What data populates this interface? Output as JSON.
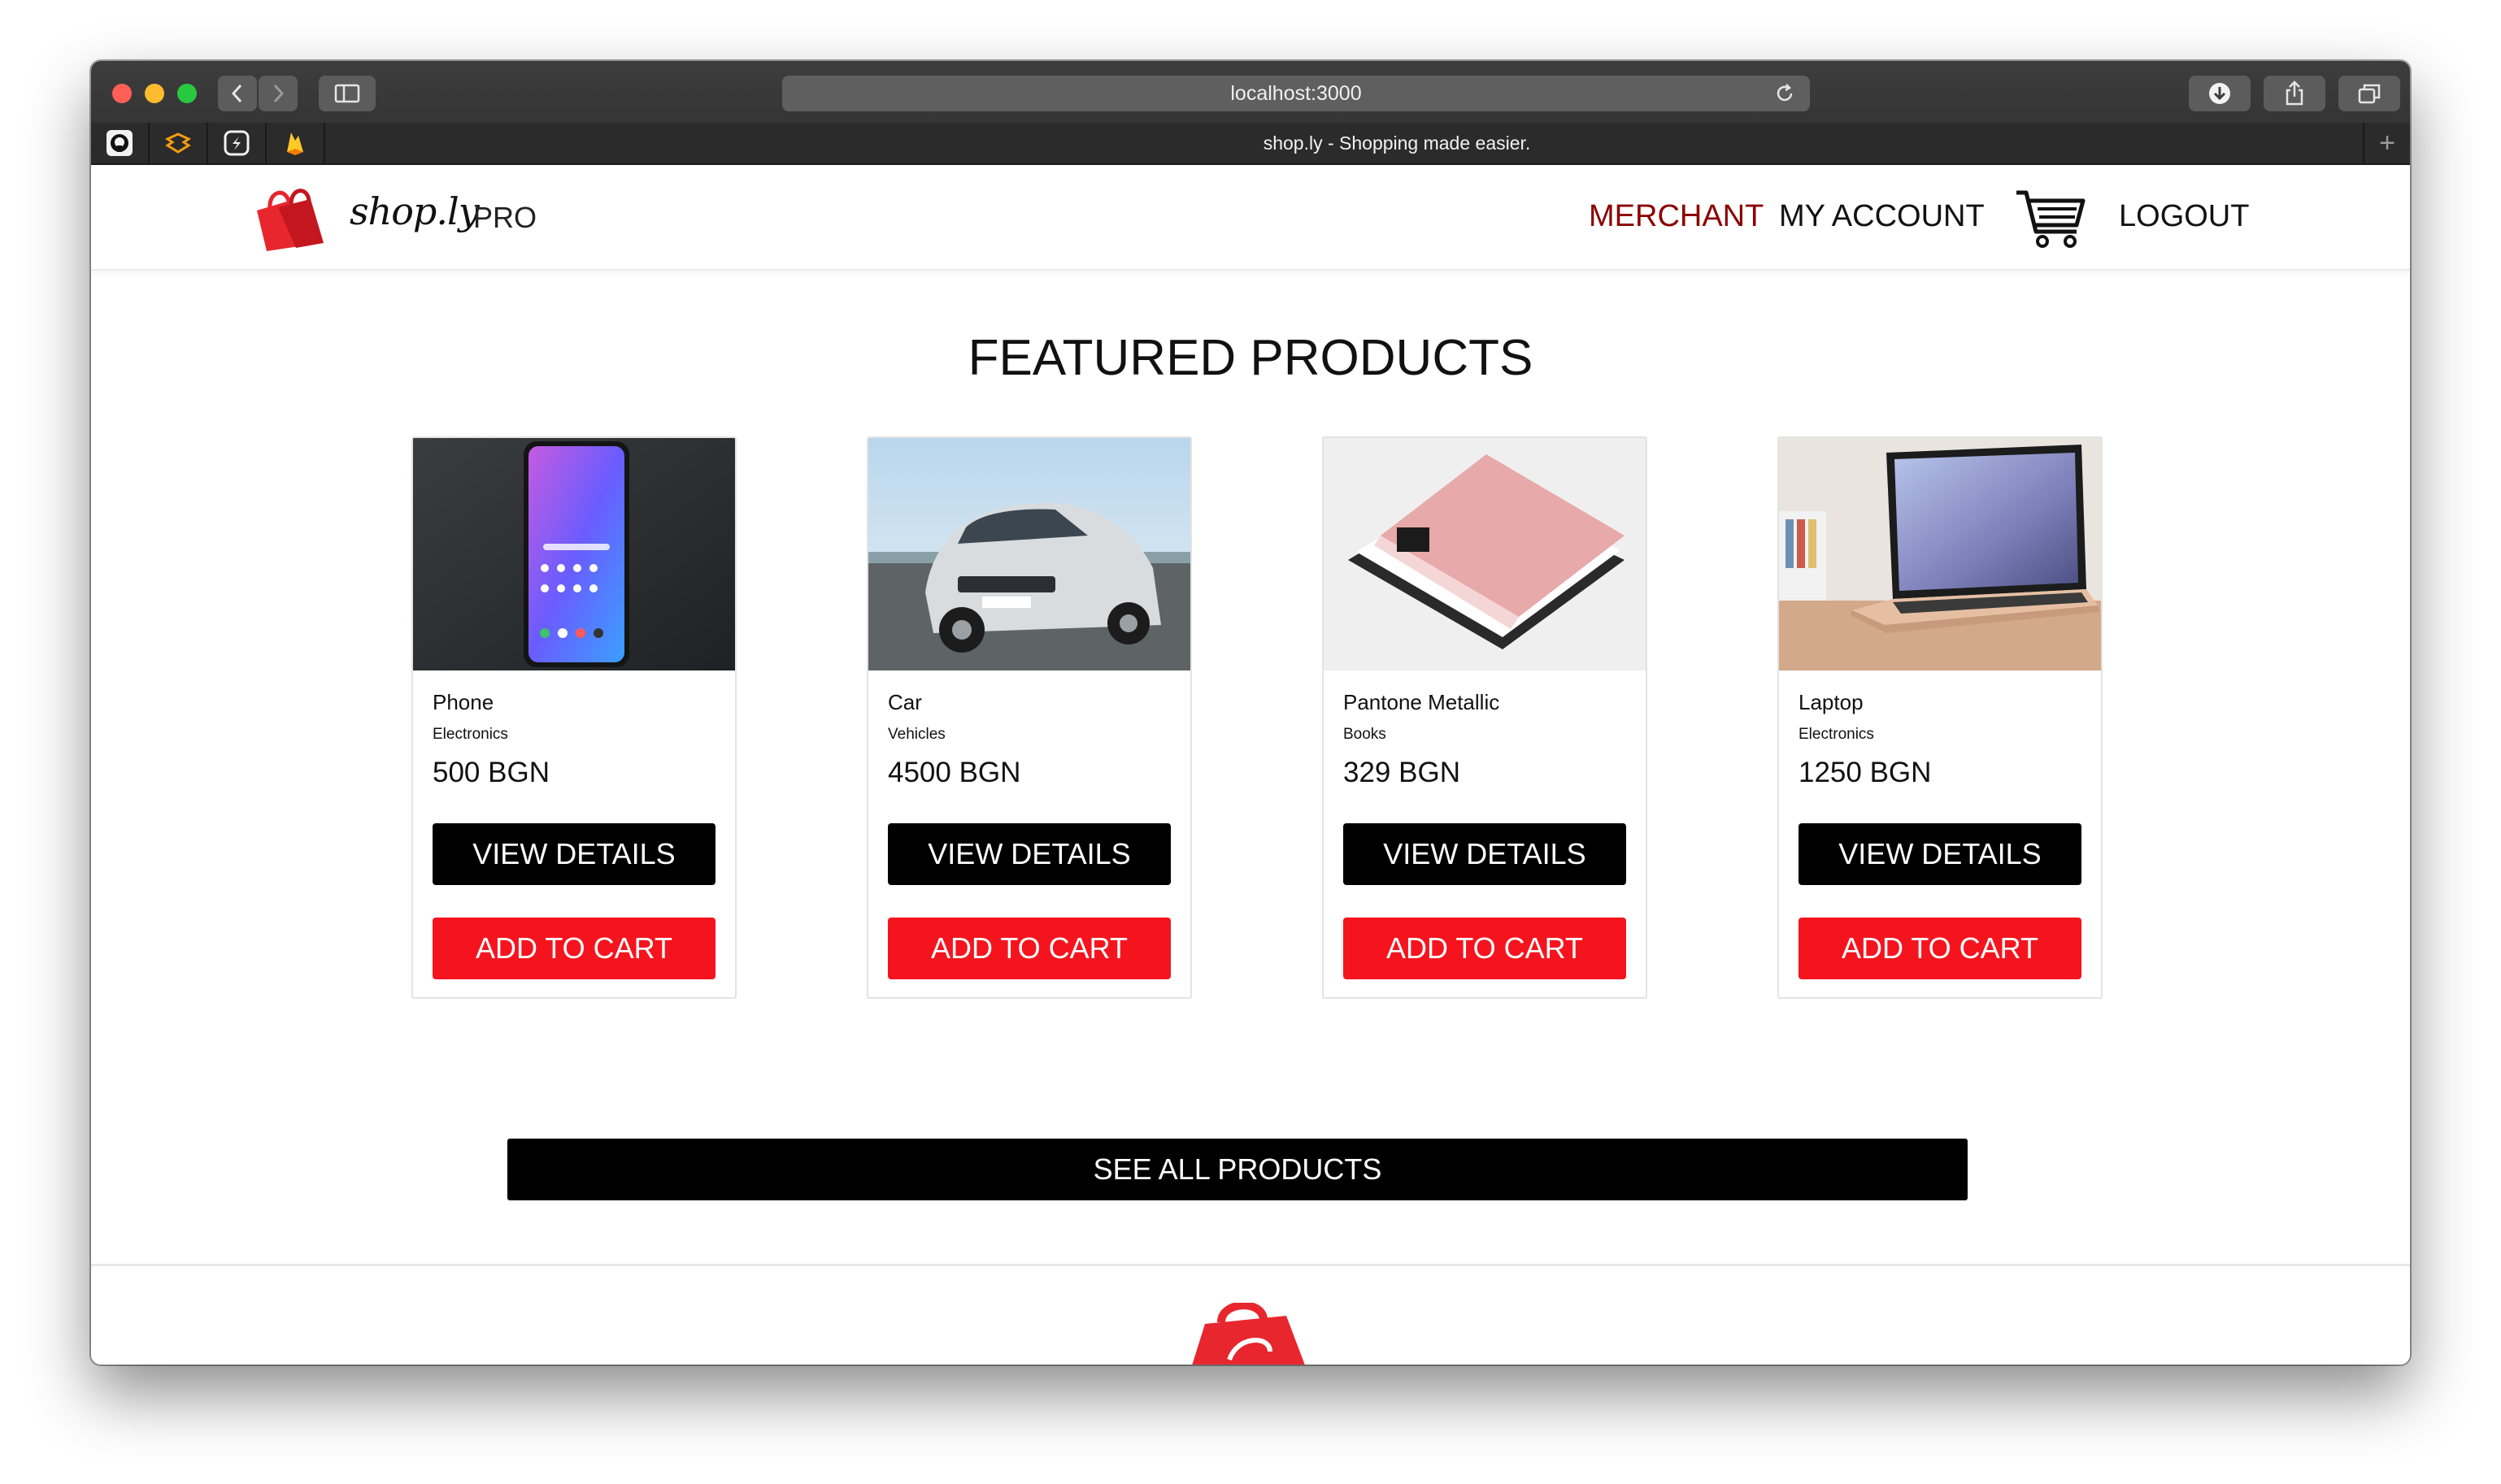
{
  "browser": {
    "url": "localhost:3000",
    "tab_title": "shop.ly - Shopping made easier.",
    "favicons": [
      "github-icon",
      "package-icon",
      "extension-icon",
      "firebase-icon"
    ]
  },
  "nav": {
    "brand": "shop.ly",
    "edition": "PRO",
    "merchant": "MERCHANT",
    "account": "MY ACCOUNT",
    "logout": "LOGOUT"
  },
  "main": {
    "heading": "FEATURED PRODUCTS",
    "see_all": "SEE ALL PRODUCTS"
  },
  "products": [
    {
      "name": "Phone",
      "category": "Electronics",
      "price": "500 BGN",
      "details_label": "VIEW DETAILS",
      "add_label": "ADD TO CART"
    },
    {
      "name": "Car",
      "category": "Vehicles",
      "price": "4500 BGN",
      "details_label": "VIEW DETAILS",
      "add_label": "ADD TO CART"
    },
    {
      "name": "Pantone Metallic",
      "category": "Books",
      "price": "329 BGN",
      "details_label": "VIEW DETAILS",
      "add_label": "ADD TO CART"
    },
    {
      "name": "Laptop",
      "category": "Electronics",
      "price": "1250 BGN",
      "details_label": "VIEW DETAILS",
      "add_label": "ADD TO CART"
    }
  ],
  "colors": {
    "brand_red": "#f5141e",
    "merchant_link": "#8b0000",
    "button_dark": "#000000"
  }
}
